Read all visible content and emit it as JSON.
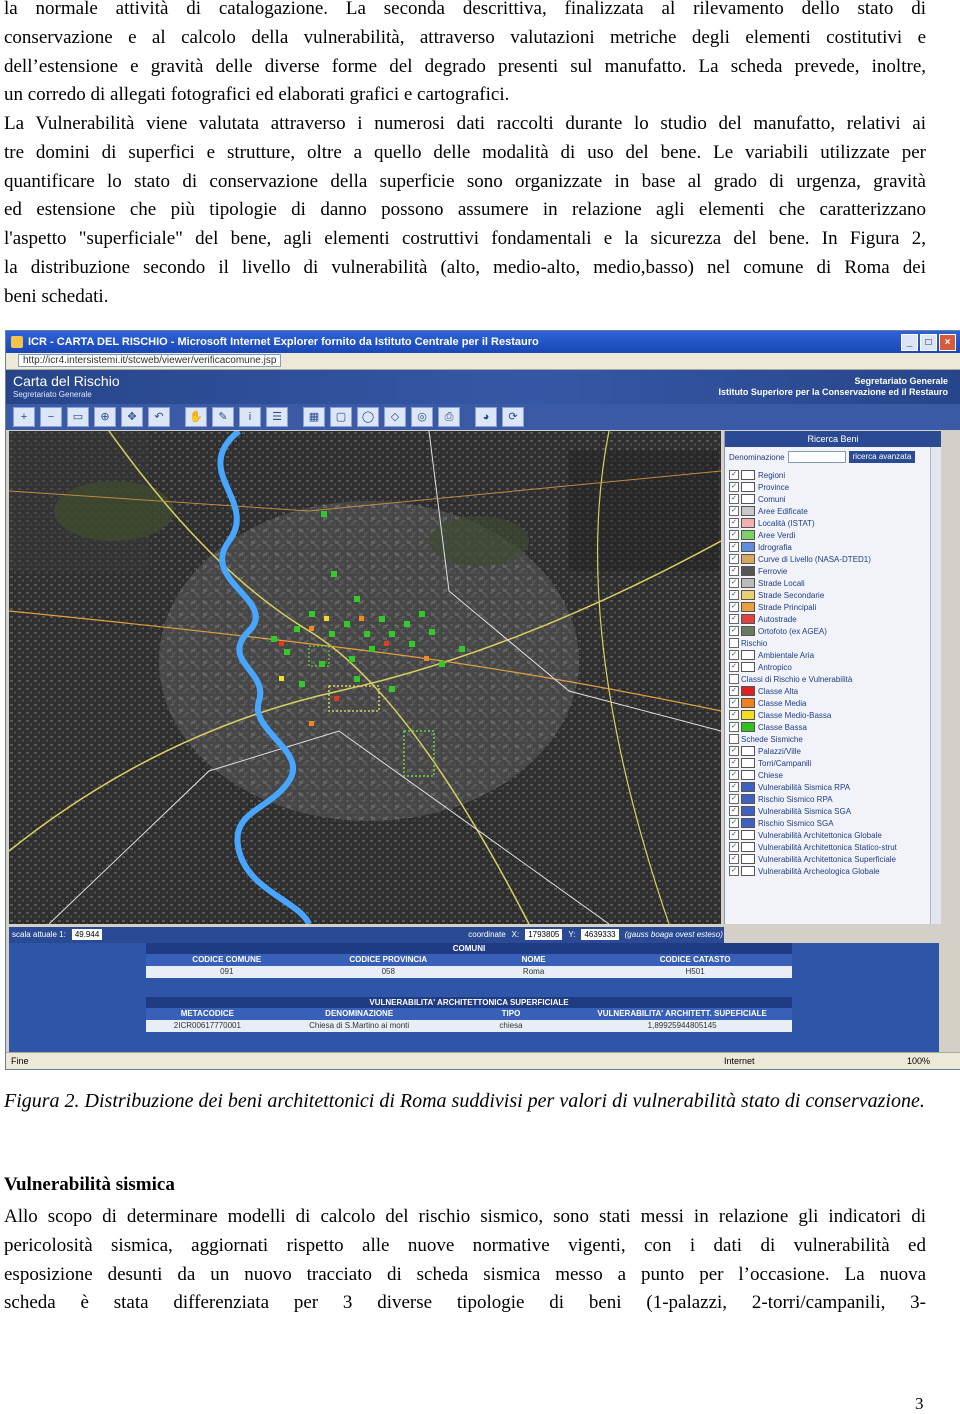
{
  "intro_lines": [
    "la normale attività di catalogazione. La seconda descrittiva, finalizzata al rilevamento dello stato di",
    "conservazione e al calcolo della vulnerabilità, attraverso valutazioni metriche degli elementi costitutivi e",
    "dell’estensione e gravità delle diverse forme del degrado presenti sul manufatto. La scheda prevede, inoltre,",
    "un corredo di allegati fotografici ed elaborati grafici e cartografici."
  ],
  "vuln_lines": [
    "La Vulnerabilità viene valutata attraverso i numerosi dati raccolti durante lo studio del manufatto, relativi ai",
    "tre domini di superfici e strutture, oltre a quello delle modalità di uso del bene. Le variabili utilizzate per",
    "quantificare lo stato di conservazione della superficie sono organizzate in base al grado di urgenza, gravità",
    "ed estensione che più tipologie di danno possono assumere in relazione agli elementi che caratterizzano",
    "l'aspetto \"superficiale\" del bene, agli elementi costruttivi fondamentali  e la sicurezza del bene.  In Figura 2,",
    "la distribuzione secondo il livello di vulnerabilità (alto, medio-alto, medio,basso) nel comune di Roma dei",
    "beni schedati."
  ],
  "screenshot": {
    "window_title": "ICR - CARTA DEL RISCHIO - Microsoft Internet Explorer fornito da Istituto Centrale per il Restauro",
    "address": "http://icr4.intersistemi.it/stcweb/viewer/verificacomune.jsp",
    "app_logo": "Carta del Rischio",
    "app_logo_sub": "Segretariato Generale",
    "app_right_line1": "Segretariato Generale",
    "app_right_line2": "Istituto Superiore per la Conservazione ed il Restauro",
    "panel_title": "Ricerca Beni",
    "search_label": "Denominazione",
    "search_button": "ricerca avanzata",
    "layers": [
      {
        "label": "Regioni",
        "color": "#ffffff"
      },
      {
        "label": "Province",
        "color": "#ffffff"
      },
      {
        "label": "Comuni",
        "color": "#ffffff"
      },
      {
        "label": "Aree Edificate",
        "color": "#c8c8c8"
      },
      {
        "label": "Località (ISTAT)",
        "color": "#f0b0b0"
      },
      {
        "label": "Aree Verdi",
        "color": "#7fcf6a"
      },
      {
        "label": "Idrografia",
        "color": "#5f8fdc"
      },
      {
        "label": "Curve di Livello (NASA-DTED1)",
        "color": "#d9a860"
      },
      {
        "label": "Ferrovie",
        "color": "#555555"
      },
      {
        "label": "Strade Locali",
        "color": "#bbbbbb"
      },
      {
        "label": "Strade Secondarie",
        "color": "#e8d070"
      },
      {
        "label": "Strade Principali",
        "color": "#e8a040"
      },
      {
        "label": "Autostrade",
        "color": "#e04040"
      },
      {
        "label": "Ortofoto (ex AGEA)",
        "color": "#6a7a5a"
      },
      {
        "label": "Rischio",
        "color": "",
        "group": true
      },
      {
        "label": "Ambientale Aria",
        "color": "#ffffff"
      },
      {
        "label": "Antropico",
        "color": "#ffffff"
      },
      {
        "label": "Classi di Rischio e Vulnerabilità",
        "color": "",
        "group": true
      },
      {
        "label": "Classe Alta",
        "color": "#e02020"
      },
      {
        "label": "Classe Media",
        "color": "#f08020"
      },
      {
        "label": "Classe Medio-Bassa",
        "color": "#f0e020"
      },
      {
        "label": "Classe Bassa",
        "color": "#30c020"
      },
      {
        "label": "Schede Sismiche",
        "color": "",
        "group": true
      },
      {
        "label": "Palazzi/Ville",
        "color": "#ffffff"
      },
      {
        "label": "Torri/Campanili",
        "color": "#ffffff"
      },
      {
        "label": "Chiese",
        "color": "#ffffff"
      },
      {
        "label": "Vulnerabilità Sismica RPA",
        "color": "#4060c0"
      },
      {
        "label": "Rischio Sismico RPA",
        "color": "#4060c0"
      },
      {
        "label": "Vulnerabilità Sismica SGA",
        "color": "#4060c0"
      },
      {
        "label": "Rischio Sismico SGA",
        "color": "#4060c0"
      },
      {
        "label": "Vulnerabilità Architettonica Globale",
        "color": "#ffffff"
      },
      {
        "label": "Vulnerabilità Architettonica Statico-strut",
        "color": "#ffffff"
      },
      {
        "label": "Vulnerabilità Architettonica Superficiale",
        "color": "#ffffff"
      },
      {
        "label": "Vulnerabilità Archeologica Globale",
        "color": "#ffffff"
      }
    ],
    "scale_label": "scala attuale 1:",
    "scale_value": "49.944",
    "coord_label": "coordinate",
    "coord_x_label": "X:",
    "coord_x": "1793805",
    "coord_y_label": "Y:",
    "coord_y": "4639333",
    "coord_note": "(gauss boaga ovest esteso)",
    "comuni_table": {
      "title": "COMUNI",
      "headers": [
        "CODICE COMUNE",
        "CODICE PROVINCIA",
        "NOME",
        "CODICE CATASTO"
      ],
      "values": [
        "091",
        "058",
        "Roma",
        "H501"
      ]
    },
    "vuln_table": {
      "title": "VULNERABILITA' ARCHITETTONICA SUPERFICIALE",
      "headers": [
        "METACODICE",
        "DENOMINAZIONE",
        "TIPO",
        "VULNERABILITA' ARCHITETT. SUPEFICIALE"
      ],
      "values": [
        "2ICR00617770001",
        "Chiesa di S.Martino ai monti",
        "chiesa",
        "1,89925944805145"
      ]
    },
    "status_left": "Fine",
    "status_zone": "Internet",
    "status_zoom": "100%"
  },
  "caption": "Figura 2. Distribuzione dei beni architettonici di Roma suddivisi per valori di vulnerabilità stato di conservazione.",
  "seismic_heading": "Vulnerabilità sismica",
  "seismic_lines": [
    "Allo scopo di determinare modelli di calcolo del rischio sismico, sono stati messi in relazione gli indicatori di",
    "pericolosità sismica, aggiornati rispetto alle nuove normative vigenti, con i dati di vulnerabilità ed",
    "esposizione desunti da un nuovo tracciato di scheda sismica messo a punto per l’occasione. La nuova",
    "scheda è stata differenziata per 3 diverse tipologie di beni   (1-palazzi, 2-torri/campanili, 3-"
  ],
  "page_number": "3"
}
